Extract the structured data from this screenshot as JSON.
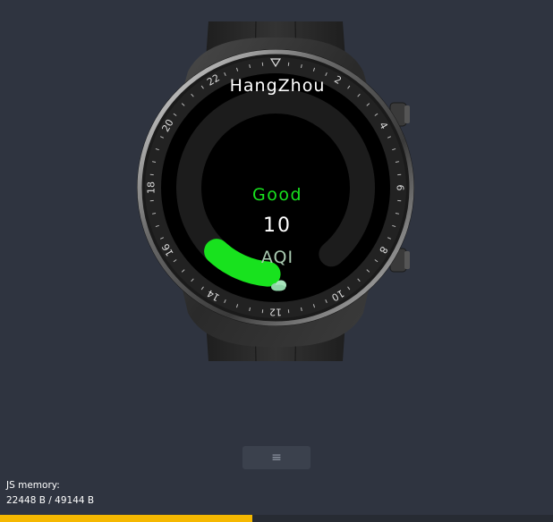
{
  "watch_face": {
    "city": "HangZhou",
    "aqi_status": "Good",
    "aqi_value": "10",
    "aqi_unit": "AQI",
    "aqi_fraction": 0.1,
    "status_color": "#18e21e",
    "weather_icon": "cloud-icon",
    "bezel_numbers": [
      "2",
      "4",
      "6",
      "8",
      "10",
      "12",
      "14",
      "16",
      "18",
      "20",
      "22"
    ]
  },
  "toolbar": {
    "menu_icon": "hamburger-menu-icon",
    "menu_glyph": "≡"
  },
  "memory": {
    "title": "JS memory:",
    "value": "22448 B / 49144 B",
    "used_fraction": 0.4568,
    "bar_color": "#f5b800"
  }
}
